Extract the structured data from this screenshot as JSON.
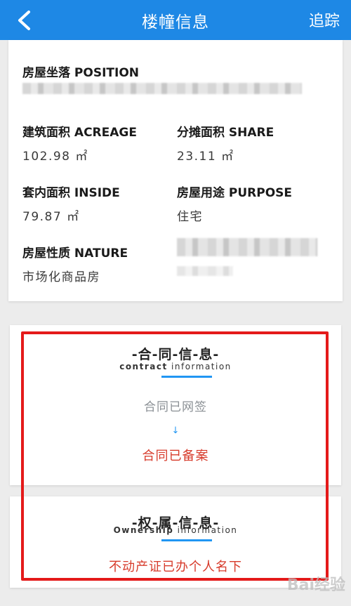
{
  "header": {
    "title": "楼幢信息",
    "track_label": "追踪"
  },
  "info": {
    "position_label": "房屋坐落 POSITION",
    "acreage_label": "建筑面积 ACREAGE",
    "acreage_value": "102.98 ㎡",
    "share_label": "分摊面积 SHARE",
    "share_value": "23.11 ㎡",
    "inside_label": "套内面积 INSIDE",
    "inside_value": "79.87 ㎡",
    "purpose_label": "房屋用途 PURPOSE",
    "purpose_value": "住宅",
    "nature_label": "房屋性质 NATURE",
    "nature_value": "市场化商品房"
  },
  "contract": {
    "title": "-合-同-信-息-",
    "subtitle_bold": "contract",
    "subtitle_rest": " information",
    "status": "合同已网签",
    "arrow": "↓",
    "filed": "合同已备案"
  },
  "ownership": {
    "title": "-权-属-信-息-",
    "subtitle_bold": "Ownership",
    "subtitle_rest": " information",
    "status": "不动产证已办个人名下"
  },
  "colors": {
    "header_bg": "#1e88e5",
    "accent_blue": "#2196f3",
    "status_red": "#d73b2b",
    "highlight_red": "#e41a1a"
  },
  "watermark": "Bai经验"
}
